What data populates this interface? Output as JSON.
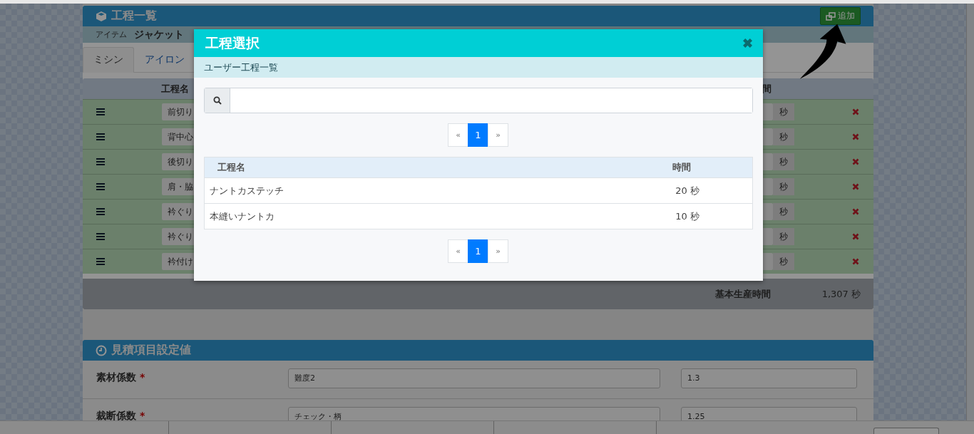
{
  "panel": {
    "title": "工程一覧",
    "add_button": "追加",
    "item_label": "アイテム",
    "item_value": "ジャケット",
    "tabs": [
      {
        "label": "ミシン",
        "selected": true
      },
      {
        "label": "アイロン",
        "selected": false
      }
    ],
    "column_1": "工程名",
    "column_2": "間",
    "rows": [
      {
        "name": "前切り",
        "unit": "秒"
      },
      {
        "name": "背中心",
        "unit": "秒"
      },
      {
        "name": "後切り",
        "unit": "秒"
      },
      {
        "name": "肩・脇",
        "unit": "秒"
      },
      {
        "name": "衿ぐり",
        "unit": "秒"
      },
      {
        "name": "衿ぐり",
        "unit": "秒"
      },
      {
        "name": "衿付け",
        "unit": "秒"
      }
    ],
    "total_label": "基本生産時間",
    "total_value": "1,307 秒"
  },
  "estimate": {
    "title": "見積項目設定値",
    "fields": [
      {
        "label": "素材係数",
        "required_mark": "*",
        "value": "難度2",
        "factor": "1.3"
      },
      {
        "label": "裁断係数",
        "required_mark": "*",
        "value": "チェック・柄",
        "factor": "1.25"
      }
    ]
  },
  "modal": {
    "title": "工程選択",
    "close": "✖",
    "subtitle": "ユーザー工程一覧",
    "pagers": [
      {
        "prev": "«",
        "next": "»",
        "pages": [
          {
            "label": "1",
            "selected": true
          }
        ]
      },
      {
        "prev": "«",
        "next": "»",
        "pages": [
          {
            "label": "1",
            "selected": true
          }
        ]
      }
    ],
    "columns": [
      "工程名",
      "時間"
    ],
    "rows": [
      {
        "name": "ナントカステッチ",
        "time": "20 秒"
      },
      {
        "name": "本縫いナントカ",
        "time": "10 秒"
      }
    ]
  }
}
